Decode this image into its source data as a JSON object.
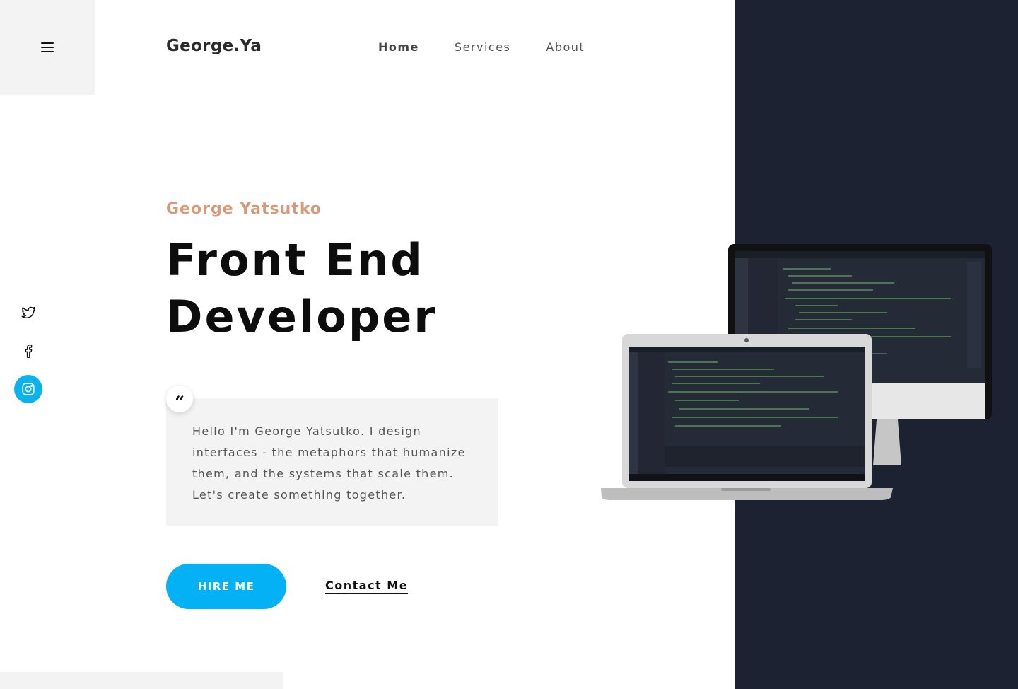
{
  "header": {
    "menu_icon": "hamburger-menu-icon",
    "logo": "George.Ya",
    "nav": [
      {
        "label": "Home",
        "active": true
      },
      {
        "label": "Services",
        "active": false
      },
      {
        "label": "About",
        "active": false
      }
    ]
  },
  "social": [
    {
      "icon": "twitter-icon",
      "active": false
    },
    {
      "icon": "facebook-icon",
      "active": false
    },
    {
      "icon": "instagram-icon",
      "active": true
    }
  ],
  "hero": {
    "subtitle": "George Yatsutko",
    "headline_line1": "Front End",
    "headline_line2": "Developer",
    "quote_mark": "“",
    "quote": "Hello I'm George Yatsutko. I design interfaces - the metaphors that humanize them, and the systems that scale them. Let's create something together.",
    "hire_label": "HIRE ME",
    "contact_label": "Contact Me"
  },
  "colors": {
    "accent": "#04b1f4",
    "subtitle": "#d69a7a",
    "dark_panel": "#1c2232",
    "light_gray": "#f3f3f3"
  },
  "illustration": {
    "icon": "devices-code-editor-illustration"
  }
}
